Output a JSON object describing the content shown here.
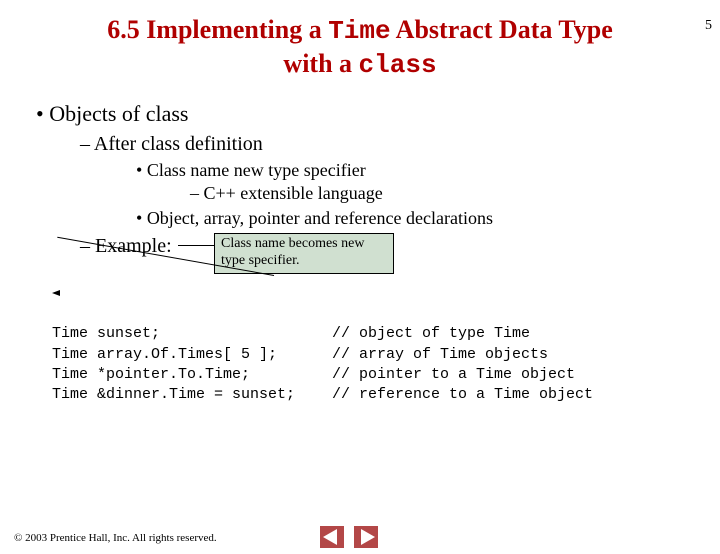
{
  "pageNumber": "5",
  "title": {
    "line1_pre": "6.5 Implementing a ",
    "line1_mono": "Time",
    "line1_post": " Abstract Data Type",
    "line2_pre": "with a ",
    "line2_mono": "class"
  },
  "bullets": {
    "l1": "Objects of class",
    "l2a": "After class definition",
    "l3a": "Class name new type specifier",
    "l4a": "C++ extensible language",
    "l3b": "Object, array, pointer and reference declarations",
    "l2b": "Example:"
  },
  "callout": {
    "line1": "Class name becomes new",
    "line2": "type specifier."
  },
  "code": [
    {
      "decl": "Time sunset;",
      "comment": "// object of type Time"
    },
    {
      "decl": "Time array.Of.Times[ 5 ];",
      "comment": "// array of Time objects"
    },
    {
      "decl": "Time *pointer.To.Time;",
      "comment": "// pointer to a Time object"
    },
    {
      "decl": "Time &dinner.Time = sunset;",
      "comment": "// reference to a Time object"
    }
  ],
  "footer": "© 2003 Prentice Hall, Inc.  All rights reserved."
}
